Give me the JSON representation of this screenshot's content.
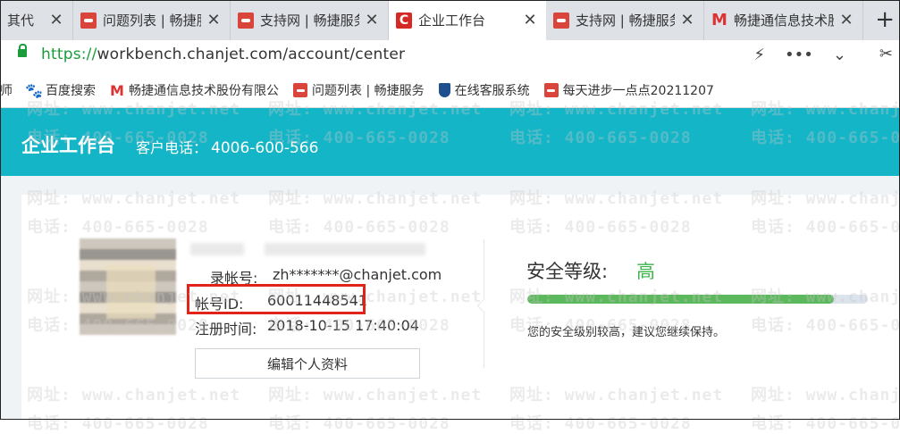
{
  "browser": {
    "tabs": [
      {
        "title": "其代",
        "icon": "tab-icon-generic"
      },
      {
        "title": "问题列表 | 畅捷服",
        "icon": "chanjet-service-icon"
      },
      {
        "title": "支持网 | 畅捷服务",
        "icon": "chanjet-service-icon"
      },
      {
        "title": "企业工作台",
        "icon": "chanjet-c-logo-icon",
        "active": true
      },
      {
        "title": "支持网 | 畅捷服务",
        "icon": "chanjet-service-icon"
      },
      {
        "title": "畅捷通信息技术股",
        "icon": "chanjet-m-logo-icon"
      }
    ],
    "tab_close_glyph": "✕",
    "new_tab_glyph": "+",
    "address": {
      "protocol": "https://",
      "host": "workbench.chanjet.com",
      "path": "/account/center"
    },
    "address_actions": {
      "lightning": "⚡",
      "more": "•••",
      "chevron": "⌄",
      "scissors": "✂"
    },
    "bookmarks": [
      {
        "label": "师",
        "icon": "none"
      },
      {
        "label": "百度搜索",
        "icon": "baidu-paw-icon"
      },
      {
        "label": "畅捷通信息技术股份有限公",
        "icon": "chanjet-m-logo-icon"
      },
      {
        "label": "问题列表 | 畅捷服务",
        "icon": "chanjet-service-icon"
      },
      {
        "label": "在线客服系统",
        "icon": "shield-icon"
      },
      {
        "label": "每天进步一点点20211207",
        "icon": "chanjet-service-icon"
      }
    ]
  },
  "app": {
    "title": "企业工作台",
    "phone_label": "客户电话：",
    "phone_number": "4006-600-566"
  },
  "account": {
    "login_label": "录帐号:",
    "login_value": "zh*******@chanjet.com",
    "id_label": "帐号ID:",
    "id_value": "60011448541",
    "reg_label": "注册时间:",
    "reg_value": "2018-10-15 17:40:04",
    "edit_button": "编辑个人资料"
  },
  "security": {
    "label": "安全等级:",
    "level": "高",
    "progress_fraction": 0.9,
    "note": "您的安全级别较高，建议您继续保持。"
  },
  "watermark": {
    "phone": "电话: 400-665-0028",
    "site": "网址: www.chanjet.net"
  },
  "colors": {
    "app_header": "#14b5c7",
    "security_high": "#3ab54a",
    "progress_fill": "#5cb85c",
    "highlight_box": "#e2231a"
  }
}
